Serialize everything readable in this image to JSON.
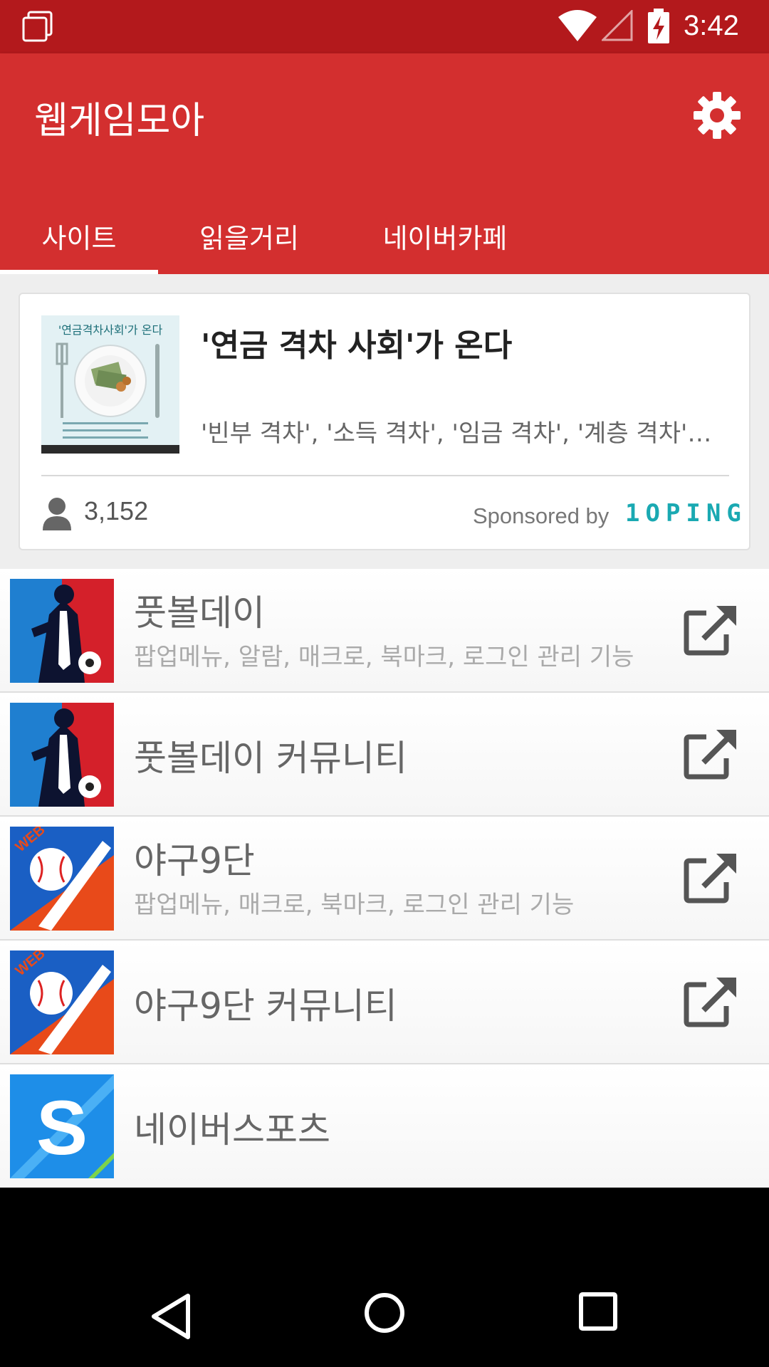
{
  "status_bar": {
    "time": "3:42",
    "icons": [
      "recent-apps-icon",
      "wifi-icon",
      "signal-icon",
      "battery-charging-icon"
    ]
  },
  "app_bar": {
    "title": "웹게임모아",
    "settings_icon": "gear-icon",
    "tabs": [
      {
        "label": "사이트",
        "selected": true
      },
      {
        "label": "읽을거리",
        "selected": false
      },
      {
        "label": "네이버카페",
        "selected": false
      }
    ]
  },
  "sponsor_card": {
    "title": "'연금 격차 사회'가 온다",
    "description": "'빈부 격차', '소득 격차', '임금 격차', '계층 격차'는…",
    "thumbnail_caption": "'연금격차사회'가 온다",
    "view_count": "3,152",
    "sponsored_by": "Sponsored by",
    "sponsor_logo": "1OPING"
  },
  "sites": [
    {
      "name": "풋볼데이",
      "description": "팝업메뉴, 알람, 매크로, 북마크, 로그인 관리 기능",
      "icon": "football-day-icon"
    },
    {
      "name": "풋볼데이 커뮤니티",
      "description": "",
      "icon": "football-day-icon"
    },
    {
      "name": "야구9단",
      "description": "팝업메뉴, 매크로, 북마크, 로그인 관리 기능",
      "icon": "baseball-9dan-icon",
      "icon_badge": "WEB"
    },
    {
      "name": "야구9단 커뮤니티",
      "description": "",
      "icon": "baseball-9dan-icon",
      "icon_badge": "WEB"
    },
    {
      "name": "네이버스포츠",
      "description": "",
      "icon": "naver-sports-icon",
      "icon_letter": "S"
    }
  ],
  "colors": {
    "status_bar": "#b3191c",
    "app_bar": "#d32f2f",
    "sponsor_logo": "#1aa9b2"
  }
}
